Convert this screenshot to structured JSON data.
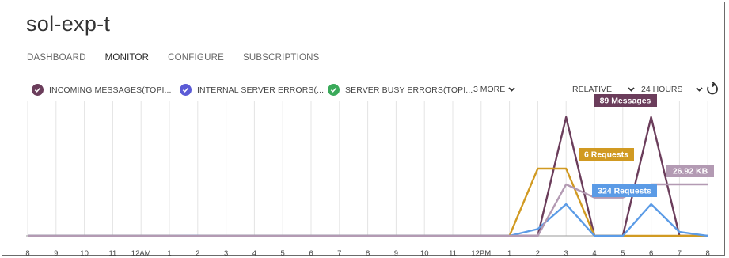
{
  "page": {
    "title": "sol-exp-t"
  },
  "tabs": [
    {
      "label": "DASHBOARD",
      "active": false
    },
    {
      "label": "MONITOR",
      "active": true
    },
    {
      "label": "CONFIGURE",
      "active": false
    },
    {
      "label": "SUBSCRIPTIONS",
      "active": false
    }
  ],
  "legend": {
    "items": [
      {
        "label": "INCOMING MESSAGES(TOPI...",
        "color": "#6b3d5b",
        "icon": "check-circle-icon"
      },
      {
        "label": "INTERNAL SERVER ERRORS(...",
        "color": "#5b5bd6",
        "icon": "check-circle-icon"
      },
      {
        "label": "SERVER BUSY ERRORS(TOPI...",
        "color": "#3aaa5a",
        "icon": "check-circle-icon"
      }
    ],
    "more_label": "3 MORE",
    "range_type": "RELATIVE",
    "range_value": "24 HOURS"
  },
  "chart_data": {
    "type": "line",
    "x": [
      "8",
      "9",
      "10",
      "11",
      "12AM",
      "1",
      "2",
      "3",
      "4",
      "5",
      "6",
      "7",
      "8",
      "9",
      "10",
      "11",
      "12PM",
      "1",
      "2",
      "3",
      "4",
      "5",
      "6",
      "7",
      "8"
    ],
    "grid": true,
    "series": [
      {
        "color": "#6b3d5b",
        "values": [
          0,
          0,
          0,
          0,
          0,
          0,
          0,
          0,
          0,
          0,
          0,
          0,
          0,
          0,
          0,
          0,
          0,
          0,
          0,
          89,
          0,
          0,
          89,
          0,
          0
        ]
      },
      {
        "color": "#d19a22",
        "values": [
          0,
          0,
          0,
          0,
          0,
          0,
          0,
          0,
          0,
          0,
          0,
          0,
          0,
          0,
          0,
          0,
          0,
          0,
          6,
          6,
          0,
          0,
          0,
          0,
          0
        ]
      },
      {
        "color": "#5b9be6",
        "values": [
          0,
          0,
          0,
          0,
          0,
          0,
          1,
          0,
          0,
          0,
          0,
          0,
          0,
          0,
          0,
          0,
          0,
          0,
          70,
          324,
          0,
          0,
          324,
          40,
          0
        ]
      },
      {
        "color": "#b39ab3",
        "values": [
          0,
          0,
          0,
          0,
          0,
          0,
          0,
          0,
          0,
          0,
          0,
          0,
          0,
          0,
          0,
          0,
          0,
          0,
          0,
          26.92,
          20,
          20,
          26.92,
          26.92,
          26.92
        ]
      }
    ],
    "annotations": [
      {
        "label": "89 Messages",
        "color": "#6b3d5b"
      },
      {
        "label": "6 Requests",
        "color": "#d19a22"
      },
      {
        "label": "324 Requests",
        "color": "#5b9be6"
      },
      {
        "label": "26.92 KB",
        "color": "#b39ab3"
      }
    ]
  }
}
